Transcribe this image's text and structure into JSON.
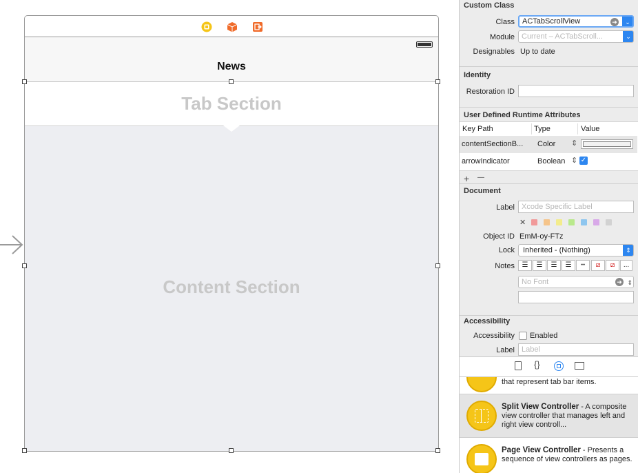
{
  "canvas": {
    "scene_title": "News",
    "tab_section_label": "Tab Section",
    "content_section_label": "Content Section"
  },
  "inspector": {
    "custom_class": {
      "section_title": "Custom Class",
      "class_label": "Class",
      "class_value": "ACTabScrollView",
      "module_label": "Module",
      "module_placeholder": "Current – ACTabScroll...",
      "designables_label": "Designables",
      "designables_value": "Up to date"
    },
    "identity": {
      "section_title": "Identity",
      "restoration_id_label": "Restoration ID",
      "restoration_id_value": ""
    },
    "runtime_attributes": {
      "section_title": "User Defined Runtime Attributes",
      "columns": [
        "Key Path",
        "Type",
        "Value"
      ],
      "rows": [
        {
          "key_path": "contentSectionB...",
          "type": "Color",
          "value": ""
        },
        {
          "key_path": "arrowIndicator",
          "type": "Boolean",
          "value": "checked"
        }
      ],
      "add_symbol": "+",
      "remove_symbol": "—"
    },
    "document": {
      "section_title": "Document",
      "label_label": "Label",
      "label_placeholder": "Xcode Specific Label",
      "clear_symbol": "✕",
      "label_colors": [
        "#f19a9a",
        "#f5c48a",
        "#f3ec8c",
        "#b9e98c",
        "#8ec6ef",
        "#d8a9e8",
        "#d2d2d2"
      ],
      "object_id_label": "Object ID",
      "object_id_value": "EmM-oy-FTz",
      "lock_label": "Lock",
      "lock_value": "Inherited - (Nothing)",
      "notes_label": "Notes",
      "font_placeholder": "No Font",
      "more_symbol": "..."
    },
    "accessibility": {
      "section_title": "Accessibility",
      "accessibility_label": "Accessibility",
      "enabled_label": "Enabled",
      "label_label": "Label",
      "label_placeholder": "Label"
    }
  },
  "library": {
    "items": [
      {
        "title": "",
        "description": "that represent tab bar items."
      },
      {
        "title": "Split View Controller",
        "description": " - A composite view controller that manages left and right view controll..."
      },
      {
        "title": "Page View Controller",
        "description": " - Presents a sequence of view controllers as pages."
      }
    ]
  },
  "colors": {
    "accent": "#2d86f0",
    "library_icon": "#f5c518",
    "content_background": "#edeef2"
  }
}
